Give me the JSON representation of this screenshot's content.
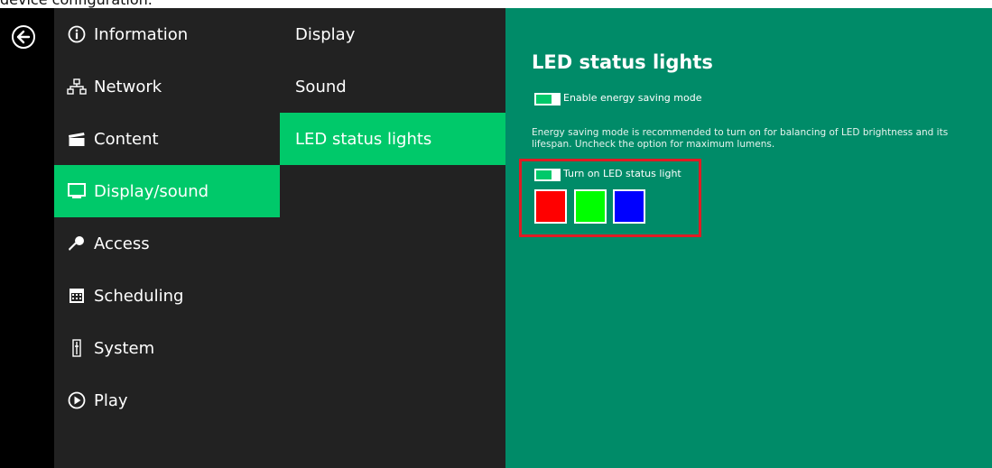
{
  "caption": "device configuration.",
  "nav": {
    "items": [
      {
        "label": "Information"
      },
      {
        "label": "Network"
      },
      {
        "label": "Content"
      },
      {
        "label": "Display/sound"
      },
      {
        "label": "Access"
      },
      {
        "label": "Scheduling"
      },
      {
        "label": "System"
      },
      {
        "label": "Play"
      }
    ],
    "active": "Display/sound"
  },
  "subnav": {
    "items": [
      {
        "label": "Display"
      },
      {
        "label": "Sound"
      },
      {
        "label": "LED status lights"
      }
    ],
    "active": "LED status lights"
  },
  "content": {
    "title": "LED status lights",
    "energy_toggle": {
      "label": "Enable energy saving mode",
      "on": true
    },
    "description": "Energy saving mode is recommended to turn on for balancing of LED brightness and its lifespan. Uncheck the option for maximum lumens.",
    "led_toggle": {
      "label": "Turn on LED status light",
      "on": true
    },
    "colors": [
      "#ff0000",
      "#00ff00",
      "#0000ff"
    ]
  },
  "theme": {
    "accent": "#00c96a",
    "panel_bg": "#008b68",
    "nav_bg": "#222222",
    "highlight_border": "#e01b24"
  }
}
